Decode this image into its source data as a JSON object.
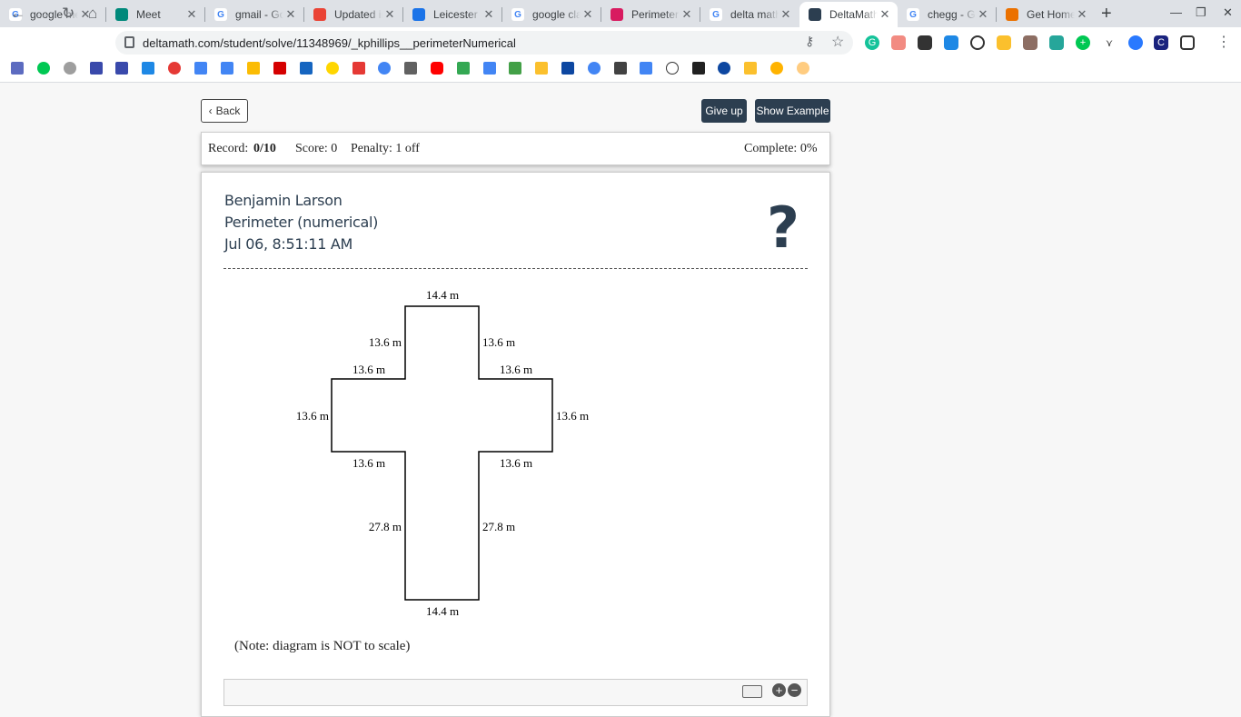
{
  "tabs": [
    {
      "title": "google me",
      "icon": "google-icon",
      "active": false
    },
    {
      "title": "Meet",
      "icon": "meet-icon",
      "active": false
    },
    {
      "title": "gmail - Go",
      "icon": "google-icon",
      "active": false
    },
    {
      "title": "Updated in",
      "icon": "gmail-icon",
      "active": false
    },
    {
      "title": "Leicester P",
      "icon": "calendar-icon",
      "active": false
    },
    {
      "title": "google cla",
      "icon": "google-icon",
      "active": false
    },
    {
      "title": "Perimeter",
      "icon": "classroom-icon",
      "active": false
    },
    {
      "title": "delta math",
      "icon": "google-icon",
      "active": false
    },
    {
      "title": "DeltaMath",
      "icon": "deltamath-icon",
      "active": true
    },
    {
      "title": "chegg - Go",
      "icon": "google-icon",
      "active": false
    },
    {
      "title": "Get Home",
      "icon": "chegg-icon",
      "active": false
    }
  ],
  "browser": {
    "url": "deltamath.com/student/solve/11348969/_kphillips__perimeterNumerical"
  },
  "header": {
    "back_label": "Back",
    "giveup_label": "Give up",
    "example_label": "Show Example"
  },
  "status": {
    "record_label": "Record:",
    "record_value": "0/10",
    "score": "Score: 0",
    "penalty": "Penalty: 1 off",
    "complete": "Complete: 0%"
  },
  "problem": {
    "student": "Benjamin Larson",
    "topic": "Perimeter (numerical)",
    "timestamp": "Jul 06, 8:51:11 AM",
    "help_symbol": "?",
    "note": "(Note: diagram is NOT to scale)"
  },
  "diagram": {
    "top": "14.4 m",
    "upper_left": "13.6 m",
    "upper_right": "13.6 m",
    "arm_top_left": "13.6 m",
    "arm_top_right": "13.6 m",
    "arm_left": "13.6 m",
    "arm_right": "13.6 m",
    "arm_bottom_left": "13.6 m",
    "arm_bottom_right": "13.6 m",
    "lower_left": "27.8 m",
    "lower_right": "27.8 m",
    "bottom": "14.4 m"
  }
}
